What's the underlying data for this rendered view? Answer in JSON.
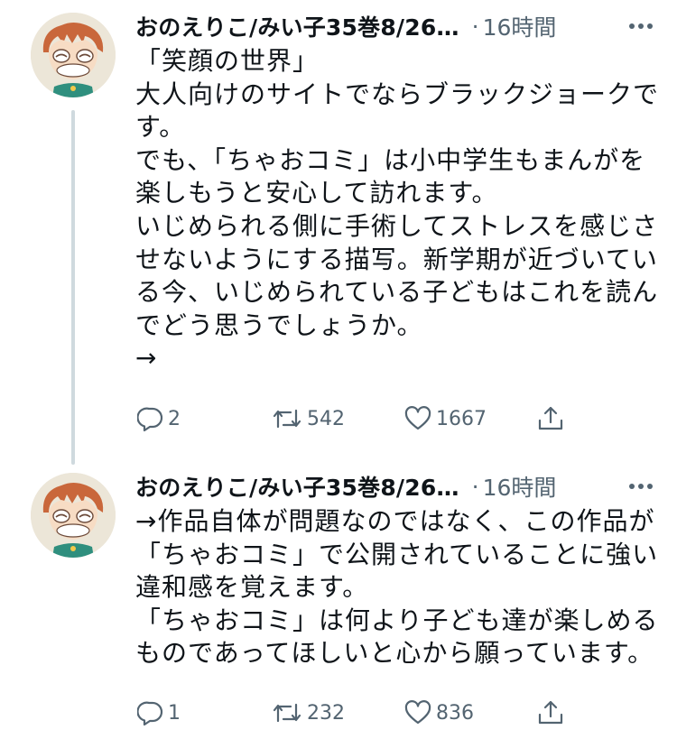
{
  "colors": {
    "text": "#0f1419",
    "muted": "#536471",
    "thread_line": "#cfd9de"
  },
  "tweets": [
    {
      "display_name": "おのえりこ/みい子35巻8/26…",
      "separator": "·",
      "time": "16時間",
      "body_lines": [
        "「笑顔の世界」",
        "大人向けのサイトでならブラックジョークで",
        "す。",
        "でも、「ちゃおコミ」は小中学生もまんがを",
        "楽しもうと安心して訪れます。",
        "いじめられる側に手術してストレスを感じさ",
        "せないようにする描写。新学期が近づいてい",
        "る今、いじめられている子どもはこれを読ん",
        "でどう思うでしょうか。",
        "→"
      ],
      "reply_count": "2",
      "retweet_count": "542",
      "like_count": "1667"
    },
    {
      "display_name": "おのえりこ/みい子35巻8/26…",
      "separator": "·",
      "time": "16時間",
      "body_lines": [
        "→作品自体が問題なのではなく、この作品が",
        "「ちゃおコミ」で公開されていることに強い",
        "違和感を覚えます。",
        "「ちゃおコミ」は何より子ども達が楽しめる",
        "ものであってほしいと心から願っています。"
      ],
      "reply_count": "1",
      "retweet_count": "232",
      "like_count": "836"
    }
  ]
}
